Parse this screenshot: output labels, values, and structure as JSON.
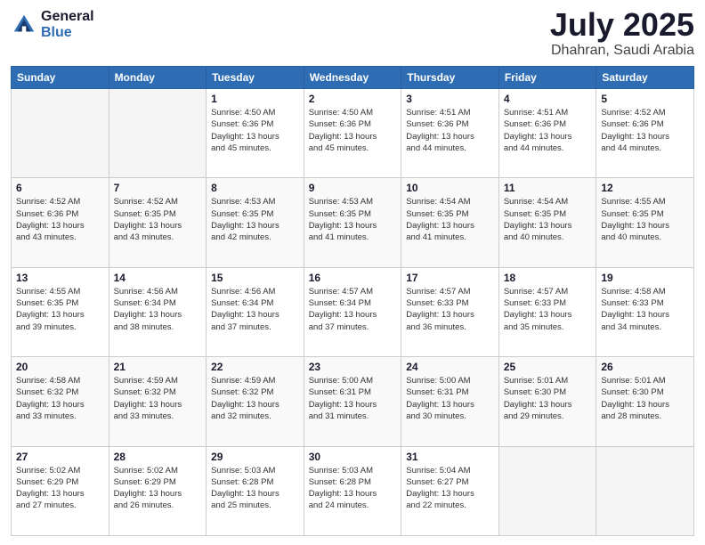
{
  "logo": {
    "general": "General",
    "blue": "Blue"
  },
  "header": {
    "month_year": "July 2025",
    "location": "Dhahran, Saudi Arabia"
  },
  "weekdays": [
    "Sunday",
    "Monday",
    "Tuesday",
    "Wednesday",
    "Thursday",
    "Friday",
    "Saturday"
  ],
  "weeks": [
    [
      {
        "day": "",
        "info": ""
      },
      {
        "day": "",
        "info": ""
      },
      {
        "day": "1",
        "info": "Sunrise: 4:50 AM\nSunset: 6:36 PM\nDaylight: 13 hours\nand 45 minutes."
      },
      {
        "day": "2",
        "info": "Sunrise: 4:50 AM\nSunset: 6:36 PM\nDaylight: 13 hours\nand 45 minutes."
      },
      {
        "day": "3",
        "info": "Sunrise: 4:51 AM\nSunset: 6:36 PM\nDaylight: 13 hours\nand 44 minutes."
      },
      {
        "day": "4",
        "info": "Sunrise: 4:51 AM\nSunset: 6:36 PM\nDaylight: 13 hours\nand 44 minutes."
      },
      {
        "day": "5",
        "info": "Sunrise: 4:52 AM\nSunset: 6:36 PM\nDaylight: 13 hours\nand 44 minutes."
      }
    ],
    [
      {
        "day": "6",
        "info": "Sunrise: 4:52 AM\nSunset: 6:36 PM\nDaylight: 13 hours\nand 43 minutes."
      },
      {
        "day": "7",
        "info": "Sunrise: 4:52 AM\nSunset: 6:35 PM\nDaylight: 13 hours\nand 43 minutes."
      },
      {
        "day": "8",
        "info": "Sunrise: 4:53 AM\nSunset: 6:35 PM\nDaylight: 13 hours\nand 42 minutes."
      },
      {
        "day": "9",
        "info": "Sunrise: 4:53 AM\nSunset: 6:35 PM\nDaylight: 13 hours\nand 41 minutes."
      },
      {
        "day": "10",
        "info": "Sunrise: 4:54 AM\nSunset: 6:35 PM\nDaylight: 13 hours\nand 41 minutes."
      },
      {
        "day": "11",
        "info": "Sunrise: 4:54 AM\nSunset: 6:35 PM\nDaylight: 13 hours\nand 40 minutes."
      },
      {
        "day": "12",
        "info": "Sunrise: 4:55 AM\nSunset: 6:35 PM\nDaylight: 13 hours\nand 40 minutes."
      }
    ],
    [
      {
        "day": "13",
        "info": "Sunrise: 4:55 AM\nSunset: 6:35 PM\nDaylight: 13 hours\nand 39 minutes."
      },
      {
        "day": "14",
        "info": "Sunrise: 4:56 AM\nSunset: 6:34 PM\nDaylight: 13 hours\nand 38 minutes."
      },
      {
        "day": "15",
        "info": "Sunrise: 4:56 AM\nSunset: 6:34 PM\nDaylight: 13 hours\nand 37 minutes."
      },
      {
        "day": "16",
        "info": "Sunrise: 4:57 AM\nSunset: 6:34 PM\nDaylight: 13 hours\nand 37 minutes."
      },
      {
        "day": "17",
        "info": "Sunrise: 4:57 AM\nSunset: 6:33 PM\nDaylight: 13 hours\nand 36 minutes."
      },
      {
        "day": "18",
        "info": "Sunrise: 4:57 AM\nSunset: 6:33 PM\nDaylight: 13 hours\nand 35 minutes."
      },
      {
        "day": "19",
        "info": "Sunrise: 4:58 AM\nSunset: 6:33 PM\nDaylight: 13 hours\nand 34 minutes."
      }
    ],
    [
      {
        "day": "20",
        "info": "Sunrise: 4:58 AM\nSunset: 6:32 PM\nDaylight: 13 hours\nand 33 minutes."
      },
      {
        "day": "21",
        "info": "Sunrise: 4:59 AM\nSunset: 6:32 PM\nDaylight: 13 hours\nand 33 minutes."
      },
      {
        "day": "22",
        "info": "Sunrise: 4:59 AM\nSunset: 6:32 PM\nDaylight: 13 hours\nand 32 minutes."
      },
      {
        "day": "23",
        "info": "Sunrise: 5:00 AM\nSunset: 6:31 PM\nDaylight: 13 hours\nand 31 minutes."
      },
      {
        "day": "24",
        "info": "Sunrise: 5:00 AM\nSunset: 6:31 PM\nDaylight: 13 hours\nand 30 minutes."
      },
      {
        "day": "25",
        "info": "Sunrise: 5:01 AM\nSunset: 6:30 PM\nDaylight: 13 hours\nand 29 minutes."
      },
      {
        "day": "26",
        "info": "Sunrise: 5:01 AM\nSunset: 6:30 PM\nDaylight: 13 hours\nand 28 minutes."
      }
    ],
    [
      {
        "day": "27",
        "info": "Sunrise: 5:02 AM\nSunset: 6:29 PM\nDaylight: 13 hours\nand 27 minutes."
      },
      {
        "day": "28",
        "info": "Sunrise: 5:02 AM\nSunset: 6:29 PM\nDaylight: 13 hours\nand 26 minutes."
      },
      {
        "day": "29",
        "info": "Sunrise: 5:03 AM\nSunset: 6:28 PM\nDaylight: 13 hours\nand 25 minutes."
      },
      {
        "day": "30",
        "info": "Sunrise: 5:03 AM\nSunset: 6:28 PM\nDaylight: 13 hours\nand 24 minutes."
      },
      {
        "day": "31",
        "info": "Sunrise: 5:04 AM\nSunset: 6:27 PM\nDaylight: 13 hours\nand 22 minutes."
      },
      {
        "day": "",
        "info": ""
      },
      {
        "day": "",
        "info": ""
      }
    ]
  ]
}
